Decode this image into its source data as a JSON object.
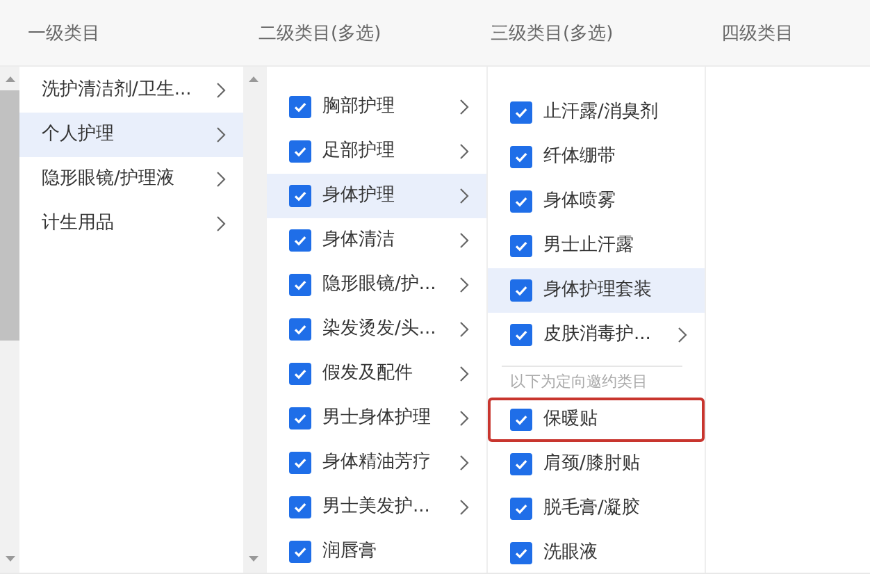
{
  "headers": [
    "一级类目",
    "二级类目(多选)",
    "三级类目(多选)",
    "四级类目"
  ],
  "level1": [
    {
      "label": "洗护清洁剂/卫生...",
      "selected": false,
      "expandable": true
    },
    {
      "label": "个人护理",
      "selected": true,
      "expandable": true
    },
    {
      "label": "隐形眼镜/护理液",
      "selected": false,
      "expandable": true
    },
    {
      "label": "计生用品",
      "selected": false,
      "expandable": true
    }
  ],
  "level2": [
    {
      "label": "胸部护理",
      "checked": true,
      "selected": false,
      "expandable": true
    },
    {
      "label": "足部护理",
      "checked": true,
      "selected": false,
      "expandable": true
    },
    {
      "label": "身体护理",
      "checked": true,
      "selected": true,
      "expandable": true
    },
    {
      "label": "身体清洁",
      "checked": true,
      "selected": false,
      "expandable": true
    },
    {
      "label": "隐形眼镜/护...",
      "checked": true,
      "selected": false,
      "expandable": true
    },
    {
      "label": "染发烫发/头...",
      "checked": true,
      "selected": false,
      "expandable": true
    },
    {
      "label": "假发及配件",
      "checked": true,
      "selected": false,
      "expandable": true
    },
    {
      "label": "男士身体护理",
      "checked": true,
      "selected": false,
      "expandable": true
    },
    {
      "label": "身体精油芳疗",
      "checked": true,
      "selected": false,
      "expandable": true
    },
    {
      "label": "男士美发护...",
      "checked": true,
      "selected": false,
      "expandable": true
    },
    {
      "label": "润唇膏",
      "checked": true,
      "selected": false,
      "expandable": false
    }
  ],
  "level3": [
    {
      "kind": "item",
      "label": "止汗露/消臭剂",
      "checked": true,
      "selected": false,
      "expandable": false,
      "outlined": false
    },
    {
      "kind": "item",
      "label": "纤体绷带",
      "checked": true,
      "selected": false,
      "expandable": false,
      "outlined": false
    },
    {
      "kind": "item",
      "label": "身体喷雾",
      "checked": true,
      "selected": false,
      "expandable": false,
      "outlined": false
    },
    {
      "kind": "item",
      "label": "男士止汗露",
      "checked": true,
      "selected": false,
      "expandable": false,
      "outlined": false
    },
    {
      "kind": "item",
      "label": "身体护理套装",
      "checked": true,
      "selected": true,
      "expandable": false,
      "outlined": false
    },
    {
      "kind": "item",
      "label": "皮肤消毒护...",
      "checked": true,
      "selected": false,
      "expandable": true,
      "outlined": false
    },
    {
      "kind": "note",
      "label": "以下为定向邀约类目"
    },
    {
      "kind": "item",
      "label": "保暖贴",
      "checked": true,
      "selected": false,
      "expandable": false,
      "outlined": true
    },
    {
      "kind": "item",
      "label": "肩颈/膝肘贴",
      "checked": true,
      "selected": false,
      "expandable": false,
      "outlined": false
    },
    {
      "kind": "item",
      "label": "脱毛膏/凝胶",
      "checked": true,
      "selected": false,
      "expandable": false,
      "outlined": false
    },
    {
      "kind": "item",
      "label": "洗眼液",
      "checked": true,
      "selected": false,
      "expandable": false,
      "outlined": false
    }
  ]
}
